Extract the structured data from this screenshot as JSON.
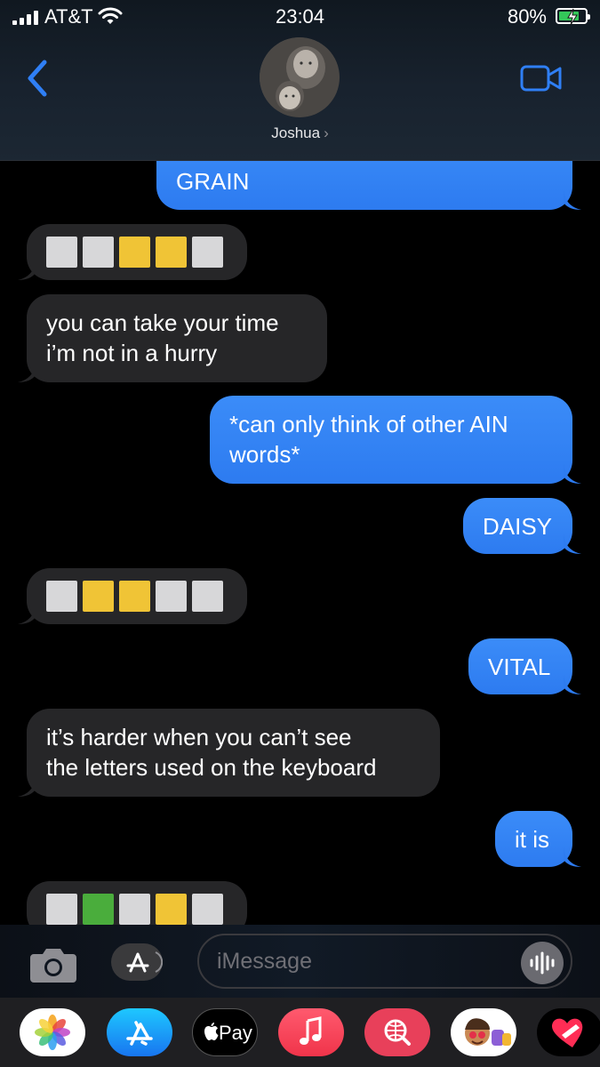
{
  "status_bar": {
    "carrier": "AT&T",
    "time": "23:04",
    "battery": "80%",
    "battery_level": 0.8
  },
  "header": {
    "contact_name": "Joshua",
    "chevron": "›"
  },
  "messages": [
    {
      "side": "out",
      "lines": [
        "GRAIN"
      ]
    },
    {
      "side": "in",
      "tiles": [
        "gray",
        "gray",
        "yellow",
        "yellow",
        "gray"
      ]
    },
    {
      "side": "in",
      "lines": [
        "you can take your time",
        "i’m not in a hurry"
      ]
    },
    {
      "side": "out",
      "lines": [
        "*can only think of other AIN",
        "words*"
      ]
    },
    {
      "side": "out",
      "lines": [
        "DAISY"
      ]
    },
    {
      "side": "in",
      "tiles": [
        "gray",
        "yellow",
        "yellow",
        "gray",
        "gray"
      ]
    },
    {
      "side": "out",
      "lines": [
        "VITAL"
      ]
    },
    {
      "side": "in",
      "lines": [
        "it’s harder when you can’t see",
        "the letters used on the keyboard"
      ]
    },
    {
      "side": "out",
      "lines": [
        "it is"
      ]
    },
    {
      "side": "in",
      "tiles": [
        "gray",
        "green",
        "gray",
        "yellow",
        "gray"
      ]
    }
  ],
  "input": {
    "placeholder": "iMessage"
  },
  "drawer": {
    "applepay_label": "Pay",
    "apps": [
      "photos-icon",
      "app-store-icon",
      "apple-pay-icon",
      "music-icon",
      "web-search-icon",
      "memoji-icon",
      "digital-touch-icon"
    ]
  },
  "colors": {
    "outgoing": "#2f7ff5",
    "incoming": "#262628",
    "tile_gray": "#d7d7d9",
    "tile_yellow": "#f0c436",
    "tile_green": "#4aad3c",
    "accent": "#2f7ff5"
  }
}
